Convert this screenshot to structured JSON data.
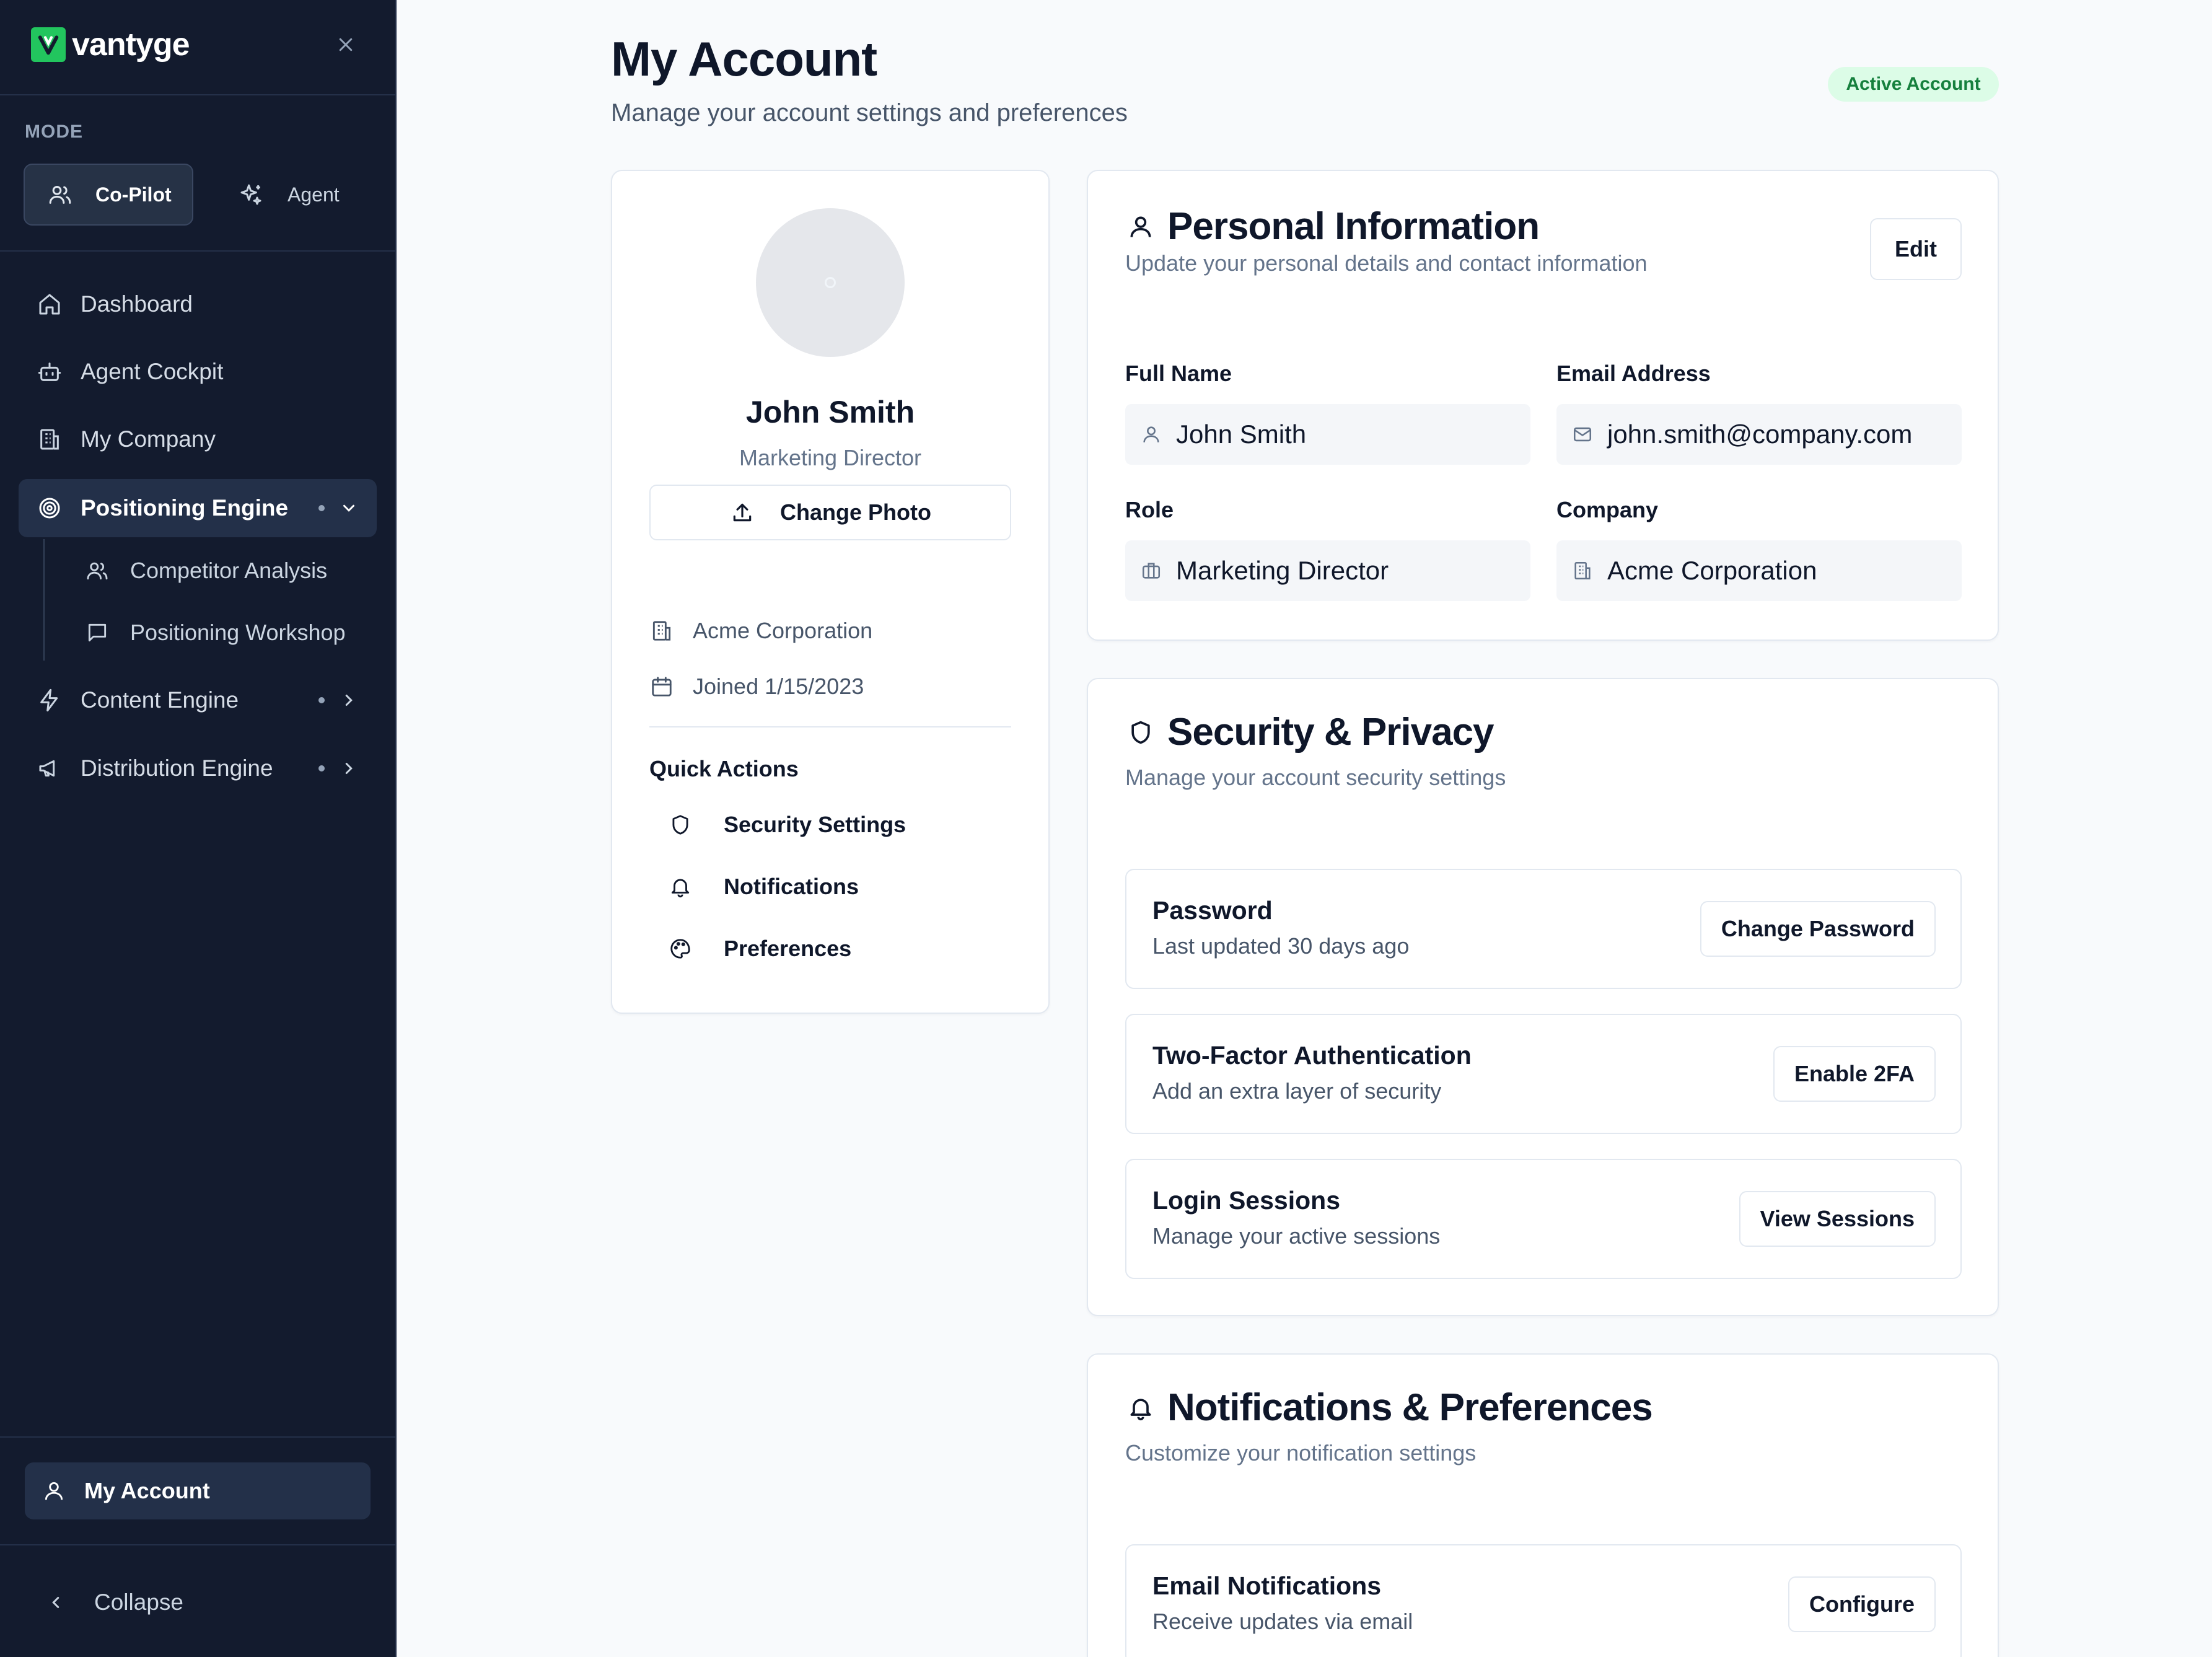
{
  "sidebar": {
    "brand": "vantyge",
    "mode_label": "MODE",
    "modes": [
      "Co-Pilot",
      "Agent"
    ],
    "nav": [
      {
        "label": "Dashboard"
      },
      {
        "label": "Agent Cockpit"
      },
      {
        "label": "My Company"
      },
      {
        "label": "Positioning Engine"
      },
      {
        "label": "Content Engine"
      },
      {
        "label": "Distribution Engine"
      }
    ],
    "sub_nav": [
      "Competitor Analysis",
      "Positioning Workshop"
    ],
    "account": "My Account",
    "collapse": "Collapse",
    "colors": {
      "background": "#131b2e",
      "active": "#233049",
      "brand_accent": "#22c55e"
    }
  },
  "header": {
    "title": "My Account",
    "subtitle": "Manage your account settings and preferences",
    "badge": "Active Account"
  },
  "profile": {
    "name": "John Smith",
    "role": "Marketing Director",
    "change_photo": "Change Photo",
    "company": "Acme Corporation",
    "joined": "Joined 1/15/2023",
    "quick_actions_title": "Quick Actions",
    "quick_actions": [
      "Security Settings",
      "Notifications",
      "Preferences"
    ]
  },
  "personal": {
    "title": "Personal Information",
    "description": "Update your personal details and contact information",
    "edit": "Edit",
    "fields": [
      {
        "label": "Full Name",
        "value": "John Smith",
        "icon": "user-icon"
      },
      {
        "label": "Email Address",
        "value": "john.smith@company.com",
        "icon": "mail-icon"
      },
      {
        "label": "Role",
        "value": "Marketing Director",
        "icon": "briefcase-icon"
      },
      {
        "label": "Company",
        "value": "Acme Corporation",
        "icon": "building-icon"
      }
    ]
  },
  "security": {
    "title": "Security & Privacy",
    "description": "Manage your account security settings",
    "rows": [
      {
        "title": "Password",
        "desc": "Last updated 30 days ago",
        "button": "Change Password"
      },
      {
        "title": "Two-Factor Authentication",
        "desc": "Add an extra layer of security",
        "button": "Enable 2FA"
      },
      {
        "title": "Login Sessions",
        "desc": "Manage your active sessions",
        "button": "View Sessions"
      }
    ]
  },
  "notifications": {
    "title": "Notifications & Preferences",
    "description": "Customize your notification settings",
    "rows": [
      {
        "title": "Email Notifications",
        "desc": "Receive updates via email",
        "button": "Configure"
      }
    ]
  },
  "colors": {
    "badge_bg": "#dcfce7",
    "badge_text": "#15803d",
    "page_bg": "#f8fafc"
  }
}
